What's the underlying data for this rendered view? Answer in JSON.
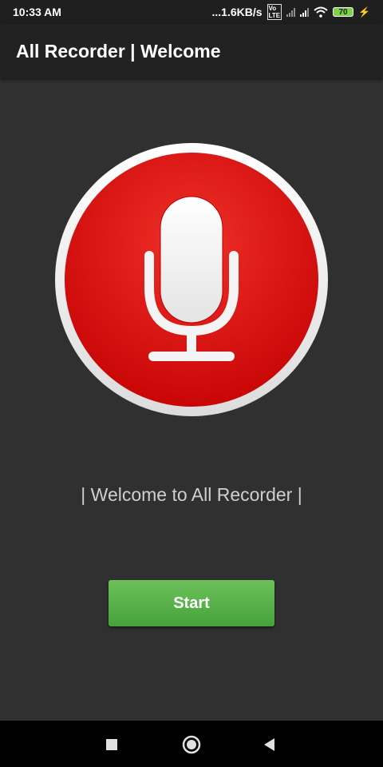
{
  "status_bar": {
    "time": "10:33 AM",
    "net_speed": "...1.6KB/s",
    "volte_label": "VoLTE",
    "battery_level": "70",
    "icons": [
      "volte-icon",
      "signal-icon",
      "signal-icon",
      "wifi-icon",
      "battery-icon",
      "charging-icon"
    ]
  },
  "app_bar": {
    "title": "All Recorder | Welcome"
  },
  "main": {
    "logo_icon": "microphone-icon",
    "welcome_text": "| Welcome to All Recorder |",
    "start_label": "Start"
  },
  "nav_bar": {
    "icons": [
      "recents-icon",
      "home-icon",
      "back-icon"
    ]
  },
  "colors": {
    "background": "#303030",
    "app_bar": "#222222",
    "mic_red": "#d90e0e",
    "start_green": "#57b146"
  }
}
